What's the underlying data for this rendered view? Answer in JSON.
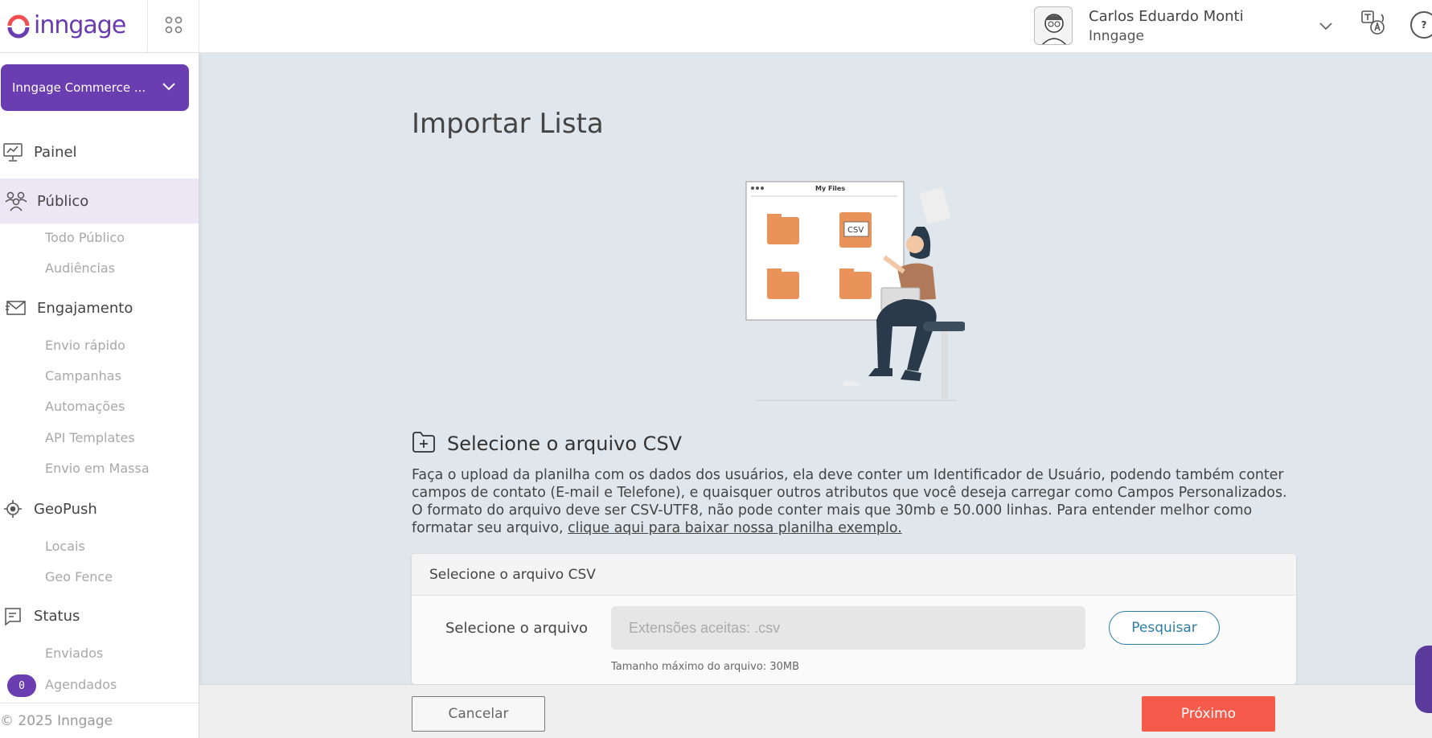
{
  "brand": {
    "name": "inngage",
    "accent": "#6a3db0",
    "cta": "#f55a4b",
    "link": "#2f7ea8"
  },
  "header": {
    "user_name": "Carlos Eduardo Monti",
    "user_org": "Inngage",
    "help_label": "?"
  },
  "sidebar": {
    "account_label": "Inngage Commerce ...",
    "nav": {
      "painel": "Painel",
      "publico": "Público",
      "publico_sub": [
        "Todo Público",
        "Audiências"
      ],
      "engajamento": "Engajamento",
      "engajamento_sub": [
        "Envio rápido",
        "Campanhas",
        "Automações",
        "API Templates",
        "Envio em Massa"
      ],
      "geopush": "GeoPush",
      "geopush_sub": [
        "Locais",
        "Geo Fence"
      ],
      "status": "Status",
      "status_sub": [
        "Enviados",
        "Agendados"
      ],
      "scheduled_count": "0"
    },
    "footer": "© 2025 Inngage"
  },
  "main": {
    "page_title": "Importar Lista",
    "illustration": {
      "window_title": "My Files",
      "file_label": "CSV"
    },
    "section_title": "Selecione o arquivo CSV",
    "description": "Faça o upload da planilha com os dados dos usuários, ela deve conter um Identificador de Usuário, podendo também conter campos de contato (E-mail e Telefone), e quaisquer outros atributos que você deseja carregar como Campos Personalizados. O formato do arquivo deve ser CSV-UTF8, não pode conter mais que 30mb e 50.000 linhas. Para entender melhor como formatar seu arquivo, ",
    "description_link": "clique aqui para baixar nossa planilha exemplo.",
    "card": {
      "header": "Selecione o arquivo CSV",
      "field_label": "Selecione o arquivo",
      "input_placeholder": "Extensões aceitas: .csv",
      "hint": "Tamanho máximo do arquivo: 30MB",
      "search_label": "Pesquisar"
    }
  },
  "footer": {
    "cancel_label": "Cancelar",
    "next_label": "Próximo"
  }
}
